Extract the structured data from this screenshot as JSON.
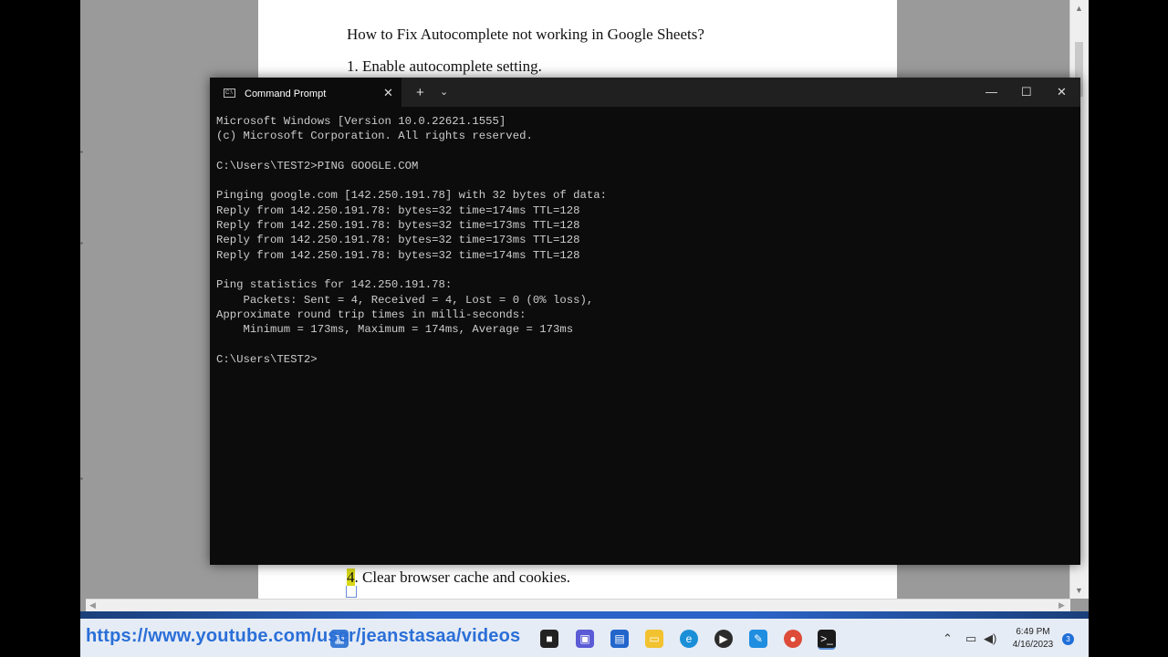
{
  "document": {
    "heading": "How to Fix Autocomplete not working in Google Sheets?",
    "item1": "1. Enable autocomplete setting.",
    "item4_number": "4",
    "item4_text": ". Clear browser cache and cookies."
  },
  "terminal": {
    "tab_title": "Command Prompt",
    "lines": [
      "Microsoft Windows [Version 10.0.22621.1555]",
      "(c) Microsoft Corporation. All rights reserved.",
      "",
      "C:\\Users\\TEST2>PING GOOGLE.COM",
      "",
      "Pinging google.com [142.250.191.78] with 32 bytes of data:",
      "Reply from 142.250.191.78: bytes=32 time=174ms TTL=128",
      "Reply from 142.250.191.78: bytes=32 time=173ms TTL=128",
      "Reply from 142.250.191.78: bytes=32 time=173ms TTL=128",
      "Reply from 142.250.191.78: bytes=32 time=174ms TTL=128",
      "",
      "Ping statistics for 142.250.191.78:",
      "    Packets: Sent = 4, Received = 4, Lost = 0 (0% loss),",
      "Approximate round trip times in milli-seconds:",
      "    Minimum = 173ms, Maximum = 174ms, Average = 173ms",
      "",
      "C:\\Users\\TEST2>"
    ]
  },
  "overlay": {
    "url": "https://www.youtube.com/user/jeanstasaa/videos"
  },
  "taskbar": {
    "time": "6:49 PM",
    "date": "4/16/2023",
    "notification_count": "3"
  },
  "icons": {
    "tab": "terminal-icon",
    "close": "close-icon",
    "new_tab": "plus-icon",
    "dropdown": "chevron-down-icon",
    "minimize": "minimize-icon",
    "maximize": "maximize-icon"
  },
  "colors": {
    "terminal_bg": "#0c0c0c",
    "terminal_text": "#cccccc",
    "titlebar": "#202020",
    "url_overlay": "#2a6fd8",
    "highlight": "#d8d81a"
  }
}
